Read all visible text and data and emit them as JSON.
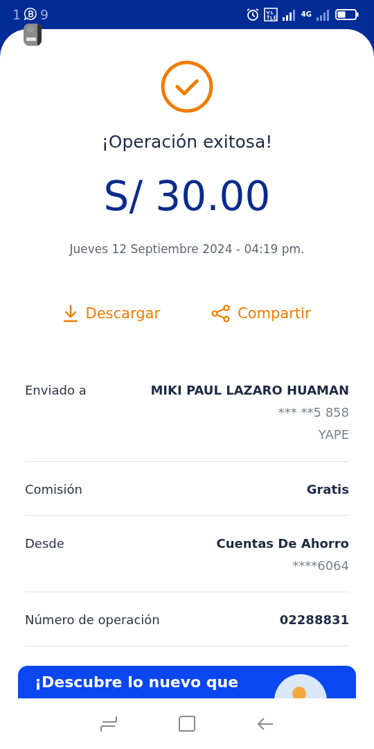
{
  "status_bar": {
    "time": [
      "1",
      "9"
    ],
    "network": "4G"
  },
  "result": {
    "title": "¡Operación exitosa!",
    "amount": "S/ 30.00",
    "date": "Jueves 12 Septiembre 2024 - 04:19 pm."
  },
  "actions": [
    {
      "kind": "download",
      "label": "Descargar"
    },
    {
      "kind": "share",
      "label": "Compartir"
    }
  ],
  "details": [
    {
      "label": "Enviado a",
      "value": "MIKI PAUL LAZARO HUAMAN",
      "sub": [
        "*** **5 858",
        "YAPE"
      ]
    },
    {
      "label": "Comisión",
      "value": "Gratis"
    },
    {
      "label": "Desde",
      "value": "Cuentas De Ahorro",
      "sub": [
        "****6064"
      ]
    },
    {
      "label": "Número de operación",
      "value": "02288831"
    }
  ],
  "banner": {
    "text": "¡Descubre lo nuevo que"
  }
}
